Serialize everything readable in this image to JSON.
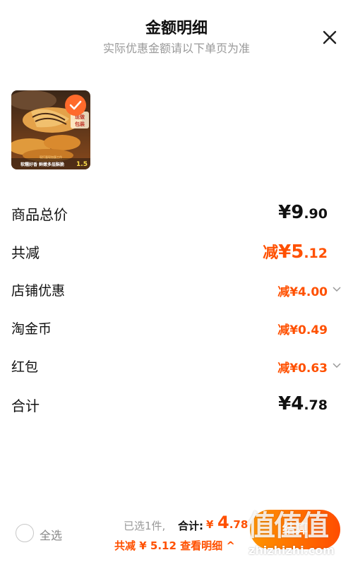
{
  "header": {
    "title": "金额明细",
    "subtitle": "实际优惠金额请以下单页为准"
  },
  "product": {
    "image_texts": [
      "现做",
      "包装",
      "现打蛋现加蛋工作",
      "软糯好香 鲜嫩多层酥脆",
      "1.5"
    ],
    "selected": true
  },
  "summary": {
    "items_total": {
      "label": "商品总价",
      "currency": "¥",
      "main": "9",
      "decimal": ".90"
    },
    "total_discount": {
      "label": "共减",
      "prefix": "减",
      "currency": "¥",
      "main": "5",
      "decimal": ".12"
    },
    "shop_discount": {
      "label": "店铺优惠",
      "value": "减¥4.00"
    },
    "tao_coin": {
      "label": "淘金币",
      "value": "减¥0.49"
    },
    "red_packet": {
      "label": "红包",
      "value": "减¥0.63"
    },
    "total": {
      "label": "合计",
      "currency": "¥",
      "main": "4",
      "decimal": ".78"
    }
  },
  "footer": {
    "select_all": "全选",
    "selected_count": "已选1件,",
    "total_label": "合计:",
    "total_currency": "¥",
    "total_main": "4",
    "total_decimal": ".78",
    "discount_text": "共减 ¥ 5.12",
    "detail_link": "查看明细 ^",
    "checkout": "结算",
    "watermark_logo": "值值值",
    "watermark_site": "zhizhizhi.com"
  },
  "colors": {
    "accent": "#ff5000",
    "button_gradient_start": "#ff9500",
    "button_gradient_end": "#ff4d00",
    "muted": "#999999"
  },
  "icons": {
    "close": "close-icon",
    "check": "check-icon",
    "chevron": "chevron-down-icon"
  }
}
